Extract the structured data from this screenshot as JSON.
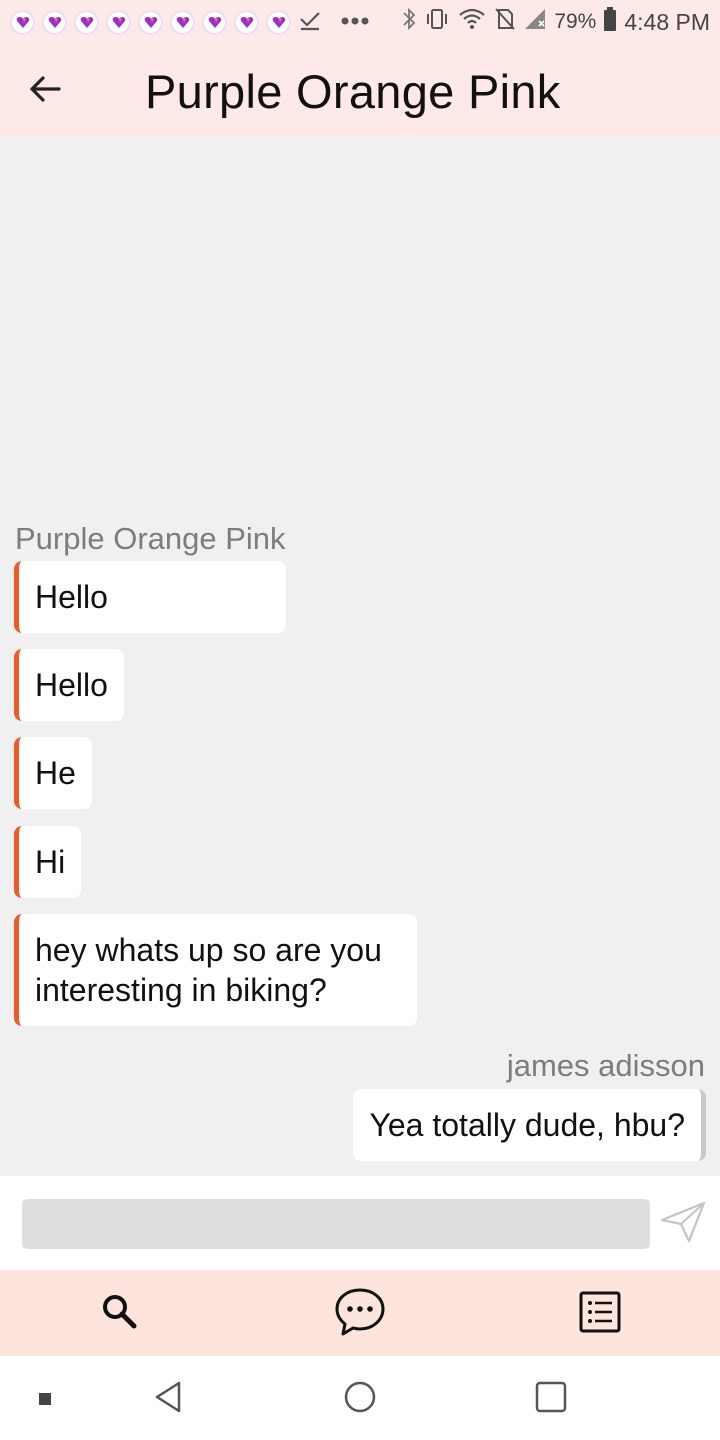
{
  "status_bar": {
    "notification_icons": [
      "app-notification-icon",
      "app-notification-icon",
      "app-notification-icon",
      "app-notification-icon",
      "app-notification-icon",
      "app-notification-icon",
      "app-notification-icon",
      "app-notification-icon",
      "app-notification-icon"
    ],
    "battery_percent": "79%",
    "time": "4:48 PM"
  },
  "header": {
    "title": "Purple Orange Pink",
    "back_icon": "arrow-left-icon"
  },
  "chat": {
    "other_user_name": "Purple Orange Pink",
    "incoming_messages": [
      {
        "text": "Hello"
      },
      {
        "text": "Hello"
      },
      {
        "text": "He"
      },
      {
        "text": "Hi"
      },
      {
        "text": "hey whats up so are you interesting in biking?"
      }
    ],
    "self_user_name": "james adisson",
    "outgoing_messages": [
      {
        "text": "Yea totally dude, hbu?"
      }
    ]
  },
  "composer": {
    "placeholder": "",
    "value": "",
    "send_icon": "send-icon"
  },
  "bottom_nav": {
    "items": [
      {
        "icon": "search-icon"
      },
      {
        "icon": "chat-bubble-icon"
      },
      {
        "icon": "list-icon"
      }
    ]
  },
  "colors": {
    "header_bg": "#fde9e8",
    "nav_bg": "#fde4dc",
    "incoming_accent": "#f05a28",
    "chat_bg": "#f0f0f0"
  }
}
